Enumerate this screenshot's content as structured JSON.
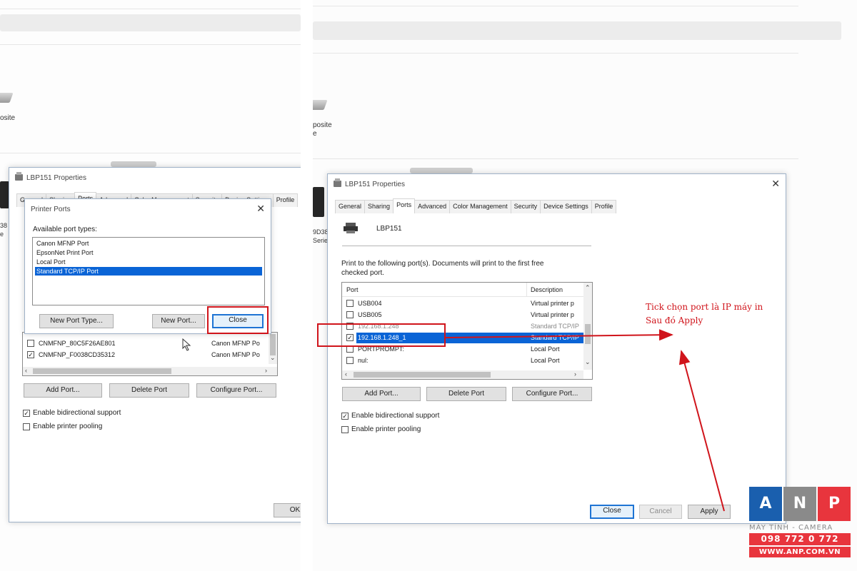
{
  "colors": {
    "annotation_red": "#d0141b",
    "selection_blue": "#0a64d6",
    "logo_blue": "#1a5fae",
    "logo_red": "#e8353d",
    "logo_gray": "#8a8a8a"
  },
  "left": {
    "bg_text_1": "osite",
    "side_text_1": "38",
    "side_text_2": "e",
    "properties": {
      "title": "LBP151 Properties",
      "tabs": [
        "General",
        "Sharing",
        "Ports",
        "Advanced",
        "Color Management",
        "Security",
        "Device Settings",
        "Profile"
      ],
      "active_tab": "Ports",
      "port_rows": [
        {
          "checked": false,
          "port": "CNMFNP_80C5F26AE801",
          "desc": "Canon MFNP Po"
        },
        {
          "checked": true,
          "port": "CNMFNP_F0038CD35312",
          "desc": "Canon MFNP Po"
        }
      ],
      "buttons": {
        "add": "Add Port...",
        "delete": "Delete Port",
        "configure": "Configure Port...",
        "ok": "OK"
      },
      "bidirectional": {
        "label": "Enable bidirectional support",
        "checked": true
      },
      "pooling": {
        "label": "Enable printer pooling",
        "checked": false
      }
    },
    "printer_ports_dialog": {
      "title": "Printer Ports",
      "label": "Available port types:",
      "items": [
        "Canon MFNP Port",
        "EpsonNet Print Port",
        "Local Port",
        "Standard TCP/IP Port"
      ],
      "selected": "Standard TCP/IP Port",
      "buttons": {
        "new_type": "New Port Type...",
        "new_port": "New Port...",
        "close": "Close"
      }
    }
  },
  "right": {
    "bg_text_1": "posite",
    "bg_text_2": "e",
    "side_text_1": "9D38",
    "side_text_2": "Serie",
    "properties": {
      "title": "LBP151 Properties",
      "tabs": [
        "General",
        "Sharing",
        "Ports",
        "Advanced",
        "Color Management",
        "Security",
        "Device Settings",
        "Profile"
      ],
      "active_tab": "Ports",
      "printer_name": "LBP151",
      "instruction": "Print to the following port(s). Documents will print to the first free checked port.",
      "columns": {
        "port": "Port",
        "description": "Description"
      },
      "port_rows": [
        {
          "checked": false,
          "port": "USB004",
          "desc": "Virtual printer p"
        },
        {
          "checked": false,
          "port": "USB005",
          "desc": "Virtual printer p"
        },
        {
          "checked": false,
          "port": "192.168.1.248",
          "desc": "Standard TCP/IP"
        },
        {
          "checked": true,
          "port": "192.168.1.248_1",
          "desc": "Standard TCP/IP",
          "selected": true
        },
        {
          "checked": false,
          "port": "PORTPROMPT:",
          "desc": "Local Port"
        },
        {
          "checked": false,
          "port": "nul:",
          "desc": "Local Port"
        }
      ],
      "buttons": {
        "add": "Add Port...",
        "delete": "Delete Port",
        "configure": "Configure Port...",
        "close": "Close",
        "cancel": "Cancel",
        "apply": "Apply"
      },
      "bidirectional": {
        "label": "Enable bidirectional support",
        "checked": true
      },
      "pooling": {
        "label": "Enable printer pooling",
        "checked": false
      }
    },
    "annotation": {
      "line1": "Tick chọn port là IP máy in",
      "line2": "Sau đó Apply"
    }
  },
  "logo": {
    "letters": [
      "A",
      "N",
      "P"
    ],
    "tagline": "MÁY TÍNH - CAMERA",
    "phone": "098 772 0 772",
    "website": "WWW.ANP.COM.VN"
  }
}
